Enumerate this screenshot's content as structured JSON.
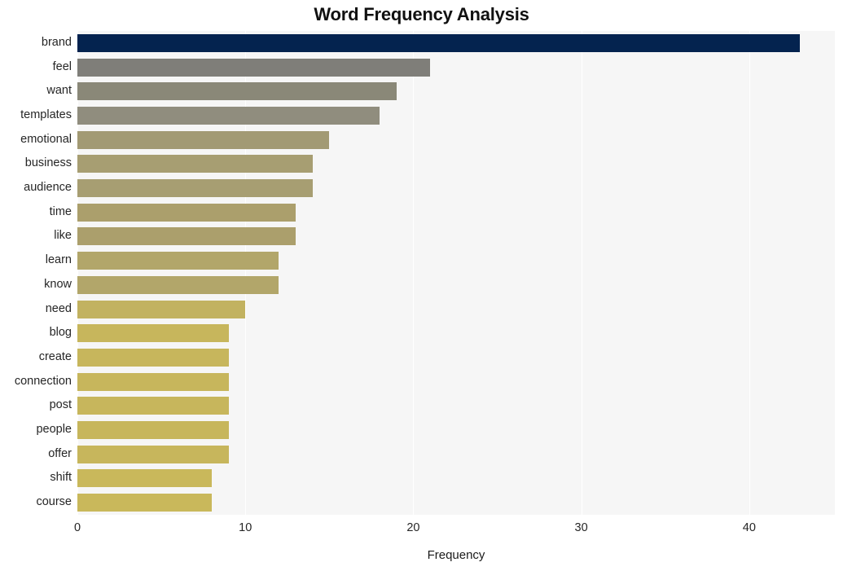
{
  "chart_data": {
    "type": "bar",
    "orientation": "horizontal",
    "title": "Word Frequency Analysis",
    "xlabel": "Frequency",
    "ylabel": "",
    "categories": [
      "brand",
      "feel",
      "want",
      "templates",
      "emotional",
      "business",
      "audience",
      "time",
      "like",
      "learn",
      "know",
      "need",
      "blog",
      "create",
      "connection",
      "post",
      "people",
      "offer",
      "shift",
      "course"
    ],
    "values": [
      43,
      21,
      19,
      18,
      15,
      14,
      14,
      13,
      13,
      12,
      12,
      10,
      9,
      9,
      9,
      9,
      9,
      9,
      8,
      8
    ],
    "bar_colors": [
      "#04234f",
      "#7f7e79",
      "#8a8878",
      "#908d7e",
      "#a29a74",
      "#a79e72",
      "#a79e72",
      "#ab9f6c",
      "#ab9f6c",
      "#b2a66a",
      "#b2a66a",
      "#c2b260",
      "#c7b65c",
      "#c7b65c",
      "#c7b65c",
      "#c7b65c",
      "#c7b65c",
      "#c7b65c",
      "#c9b85b",
      "#c9b85b"
    ],
    "xlim": [
      0,
      45.1
    ],
    "xticks": [
      0,
      10,
      20,
      30,
      40
    ],
    "xtick_labels": [
      "0",
      "10",
      "20",
      "30",
      "40"
    ],
    "grid": true,
    "grid_axis": "x",
    "legend": null,
    "plot_background": "#f6f6f6",
    "figure_background": "#ffffff",
    "gridline_color": "#ffffff"
  }
}
